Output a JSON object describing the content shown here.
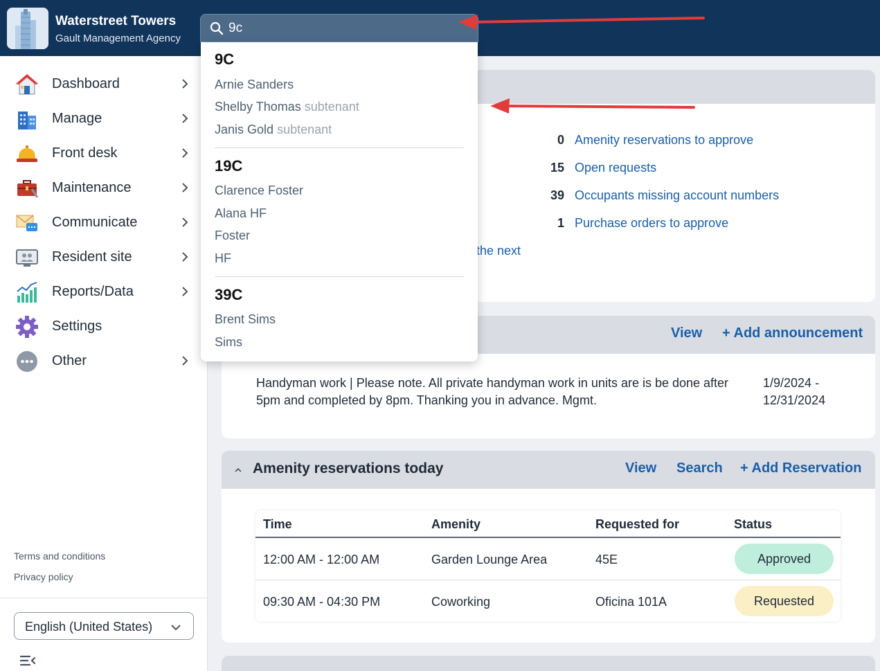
{
  "header": {
    "title": "Waterstreet Towers",
    "subtitle": "Gault Management Agency",
    "search_value": "9c"
  },
  "sidebar": {
    "items": [
      {
        "label": "Dashboard",
        "icon": "house-icon"
      },
      {
        "label": "Manage",
        "icon": "building-icon"
      },
      {
        "label": "Front desk",
        "icon": "bell-icon"
      },
      {
        "label": "Maintenance",
        "icon": "toolbox-icon"
      },
      {
        "label": "Communicate",
        "icon": "envelope-chat-icon"
      },
      {
        "label": "Resident site",
        "icon": "monitor-people-icon"
      },
      {
        "label": "Reports/Data",
        "icon": "chart-icon"
      },
      {
        "label": "Settings",
        "icon": "gear-icon"
      },
      {
        "label": "Other",
        "icon": "more-icon"
      }
    ],
    "terms": "Terms and conditions",
    "privacy": "Privacy policy",
    "language": "English (United States)"
  },
  "stats": {
    "items": [
      {
        "count": "0",
        "label": "Amenity reservations to approve"
      },
      {
        "count": "15",
        "label": "Open requests"
      },
      {
        "count": "39",
        "label": "Occupants missing account numbers"
      },
      {
        "count": "1",
        "label": "Purchase orders to approve"
      }
    ],
    "partial_text": "the next"
  },
  "announcements": {
    "view": "View",
    "add": "+ Add announcement",
    "text": "Handyman work | Please note. All private handyman work in units are is be done after 5pm and completed by 8pm. Thanking you in advance. Mgmt.",
    "date_range": "1/9/2024 - 12/31/2024"
  },
  "amenity": {
    "title": "Amenity reservations today",
    "view": "View",
    "search": "Search",
    "add": "+ Add Reservation",
    "columns": [
      "Time",
      "Amenity",
      "Requested for",
      "Status"
    ],
    "rows": [
      {
        "time": "12:00 AM - 12:00 AM",
        "amenity": "Garden Lounge Area",
        "requested_for": "45E",
        "status": "Approved"
      },
      {
        "time": "09:30 AM - 04:30 PM",
        "amenity": "Coworking",
        "requested_for": "Oficina 101A",
        "status": "Requested"
      }
    ],
    "status_colors": {
      "Approved": "#bfeedd",
      "Requested": "#fbefc6"
    }
  },
  "search_results": [
    {
      "unit": "9C",
      "people": [
        {
          "name": "Arnie Sanders",
          "tag": ""
        },
        {
          "name": "Shelby Thomas",
          "tag": "subtenant"
        },
        {
          "name": "Janis Gold",
          "tag": "subtenant"
        }
      ]
    },
    {
      "unit": "19C",
      "people": [
        {
          "name": "Clarence Foster",
          "tag": ""
        },
        {
          "name": "Alana HF",
          "tag": ""
        },
        {
          "name": "Foster",
          "tag": ""
        },
        {
          "name": "HF",
          "tag": ""
        }
      ]
    },
    {
      "unit": "39C",
      "people": [
        {
          "name": "Brent Sims",
          "tag": ""
        },
        {
          "name": "Sims",
          "tag": ""
        }
      ]
    }
  ],
  "colors": {
    "header": "#11345a",
    "link": "#1a5ea8",
    "annotation_arrow": "#e23b3b"
  }
}
